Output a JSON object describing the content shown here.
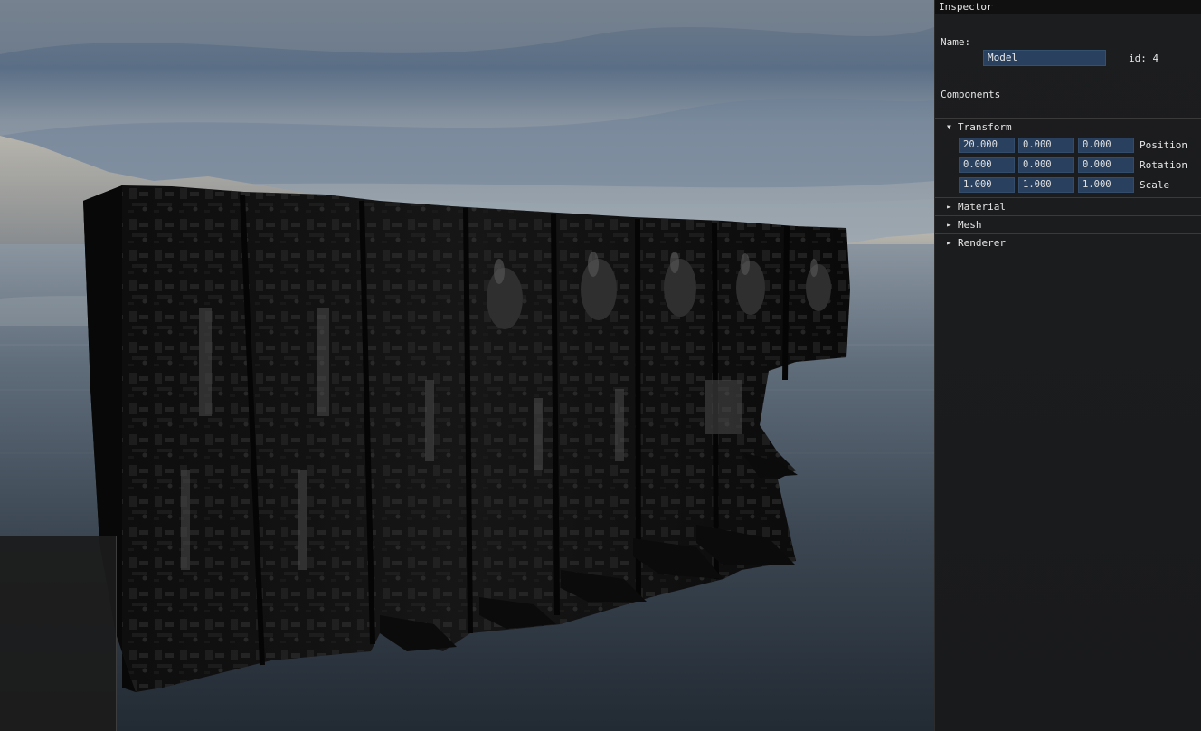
{
  "inspector": {
    "title": "Inspector",
    "name_label": "Name:",
    "name_value": "Model",
    "id_text": "id: 4",
    "components_label": "Components",
    "transform": {
      "label": "Transform",
      "position": {
        "label": "Position",
        "x": "20.000",
        "y": "0.000",
        "z": "0.000"
      },
      "rotation": {
        "label": "Rotation",
        "x": "0.000",
        "y": "0.000",
        "z": "0.000"
      },
      "scale": {
        "label": "Scale",
        "x": "1.000",
        "y": "1.000",
        "z": "1.000"
      }
    },
    "sections": {
      "material": "Material",
      "mesh": "Mesh",
      "renderer": "Renderer"
    },
    "icons": {
      "expanded": "triangle-down-icon",
      "collapsed": "triangle-right-icon"
    }
  },
  "colors": {
    "field_bg": "#29415f",
    "panel_bg": "#1c1d1f",
    "titlebar_bg": "#101010"
  }
}
